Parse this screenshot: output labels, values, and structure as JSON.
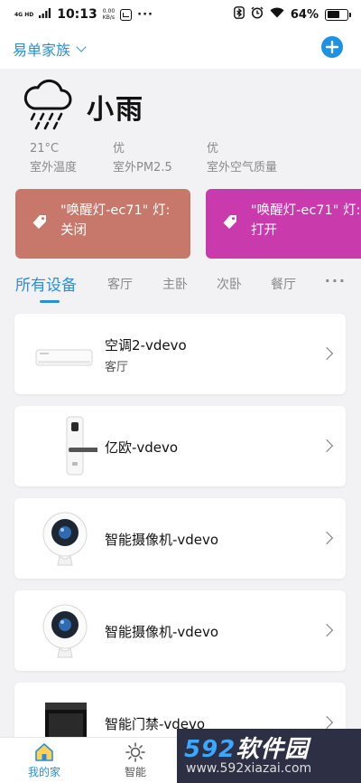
{
  "status_bar": {
    "network": "4G HD",
    "time": "10:13",
    "speed_value": "0.00",
    "speed_unit": "KB/s",
    "more": "···",
    "battery": "64%",
    "battery_level": 0.64
  },
  "header": {
    "home_name": "易单家族",
    "add_icon": "plus-circle-icon"
  },
  "weather": {
    "condition": "小雨",
    "icon": "cloud-rain-icon",
    "stats": [
      {
        "value": "21°C",
        "label": "室外温度"
      },
      {
        "value": "优",
        "label": "室外PM2.5"
      },
      {
        "value": "优",
        "label": "室外空气质量"
      }
    ]
  },
  "scenes": [
    {
      "line1": "\"唤醒灯-ec71\" 灯:",
      "line2": "关闭",
      "color": "#c7786a"
    },
    {
      "line1": "\"唤醒灯-ec71\" 灯:",
      "line2": "打开",
      "color": "#c93aad"
    }
  ],
  "tabs": {
    "items": [
      "所有设备",
      "客厅",
      "主卧",
      "次卧",
      "餐厅"
    ],
    "active_index": 0,
    "more": "···"
  },
  "devices": [
    {
      "name": "空调2-vdevo",
      "room": "客厅",
      "icon": "air-conditioner-icon"
    },
    {
      "name": "亿欧-vdevo",
      "room": "",
      "icon": "door-lock-icon"
    },
    {
      "name": "智能摄像机-vdevo",
      "room": "",
      "icon": "camera-icon"
    },
    {
      "name": "智能摄像机-vdevo",
      "room": "",
      "icon": "camera-icon"
    },
    {
      "name": "智能门禁-vdevo",
      "room": "",
      "icon": "access-control-icon"
    }
  ],
  "bottom_nav": {
    "items": [
      {
        "label": "我的家",
        "icon": "home-icon",
        "active": true
      },
      {
        "label": "智能",
        "icon": "sun-icon",
        "active": false
      }
    ]
  },
  "watermark": {
    "num": "592",
    "main": "软件园",
    "sub": "www.592xiazai.com"
  },
  "colors": {
    "accent": "#2b8fd6",
    "add_button": "#1e90e6",
    "background": "#f2f2f4"
  }
}
